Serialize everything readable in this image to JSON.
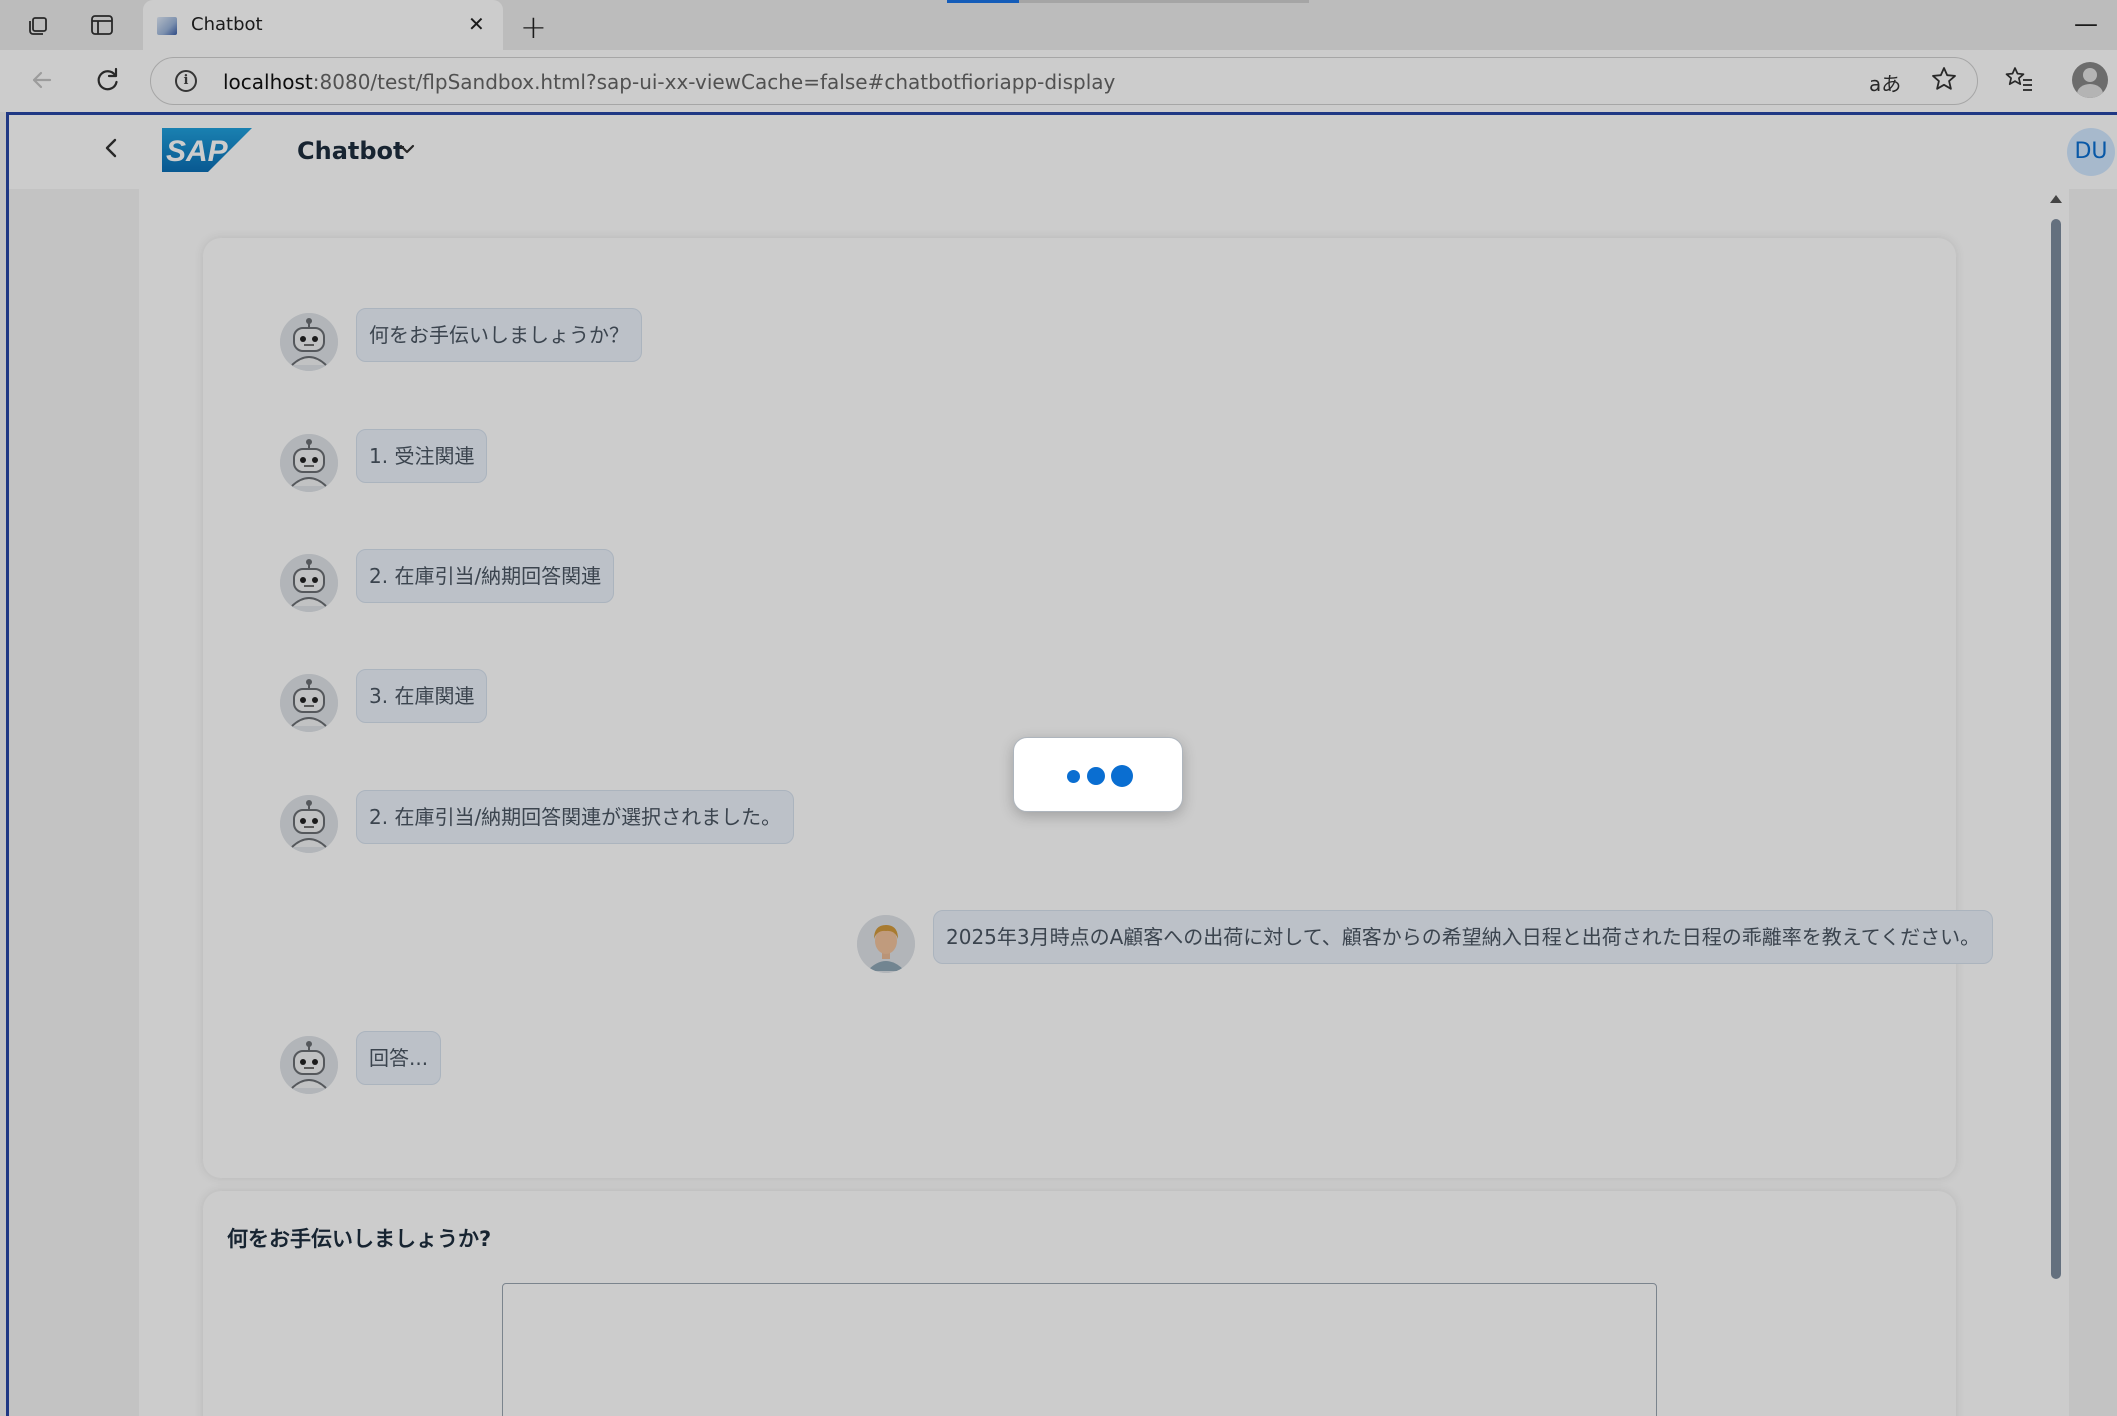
{
  "browser": {
    "tab_title": "Chatbot",
    "url_host": "localhost",
    "url_rest": ":8080/test/flpSandbox.html?sap-ui-xx-viewCache=false#chatbotfioriapp-display",
    "read_aloud_label": "aあ",
    "icons": [
      "tab-actions-icon",
      "vertical-tabs-icon",
      "new-tab-icon",
      "close-tab-icon",
      "minimize-icon",
      "back-icon",
      "refresh-icon",
      "site-info-icon",
      "read-aloud-icon",
      "favorite-star-icon",
      "favorites-icon",
      "profile-icon"
    ]
  },
  "shell": {
    "logo_text": "SAP",
    "app_title": "Chatbot",
    "avatar_initials": "DU",
    "colors": {
      "brand_blue": "#0a6ed1",
      "logo_blue": "#1a7fc4",
      "bubble": "#ebf2fb"
    }
  },
  "chat": {
    "messages": [
      {
        "sender": "bot",
        "text": "何をお手伝いしましょうか？"
      },
      {
        "sender": "bot",
        "text": "1. 受注関連"
      },
      {
        "sender": "bot",
        "text": "2. 在庫引当/納期回答関連"
      },
      {
        "sender": "bot",
        "text": "3. 在庫関連"
      },
      {
        "sender": "bot",
        "text": "2. 在庫引当/納期回答関連が選択されました。"
      },
      {
        "sender": "user",
        "text": "2025年3月時点のA顧客への出荷に対して、顧客からの希望納入日程と出荷された日程の乖離率を教えてください。"
      },
      {
        "sender": "bot",
        "text": "回答..."
      }
    ]
  },
  "input": {
    "label": "何をお手伝いしましょうか?",
    "value": ""
  },
  "busy_indicator": {
    "visible": true
  }
}
